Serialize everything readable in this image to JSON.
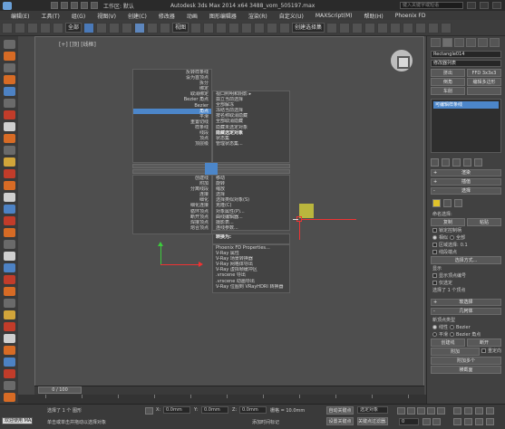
{
  "titlebar": {
    "workspace": "工作区: 默认",
    "title": "Autodesk 3ds Max  2014 x64     3488_vom_505197.max",
    "search_placeholder": "键入关键字或短语"
  },
  "menubar": [
    "编辑(E)",
    "工具(T)",
    "组(G)",
    "视图(V)",
    "创建(C)",
    "修改器",
    "动画",
    "图形编辑器",
    "渲染(R)",
    "自定义(U)",
    "MAXScript(M)",
    "帮助(H)",
    "Phoenix FD"
  ],
  "toolbar": {
    "filter": "全部",
    "ref_coord": "视图",
    "selection_set": "创建选择集"
  },
  "viewport": {
    "label": "[+] [顶] [线框]"
  },
  "quad_menu": {
    "left_top": [
      "点",
      ""
    ],
    "left_items": [
      {
        "text": "反转样条线",
        "hi": false
      },
      {
        "text": "设为首顶点",
        "hi": false
      },
      {
        "text": "拆分",
        "hi": false
      },
      {
        "text": "绑定",
        "hi": false
      },
      {
        "text": "取消绑定",
        "hi": false
      },
      {
        "text": "Bezier 角点",
        "hi": false
      },
      {
        "text": "Bezier",
        "hi": false
      },
      {
        "text": "角点",
        "hi": true
      },
      {
        "text": "平滑",
        "hi": false
      },
      {
        "text": "重置切线",
        "hi": false
      },
      {
        "text": "样条线",
        "hi": false
      },
      {
        "text": "线段",
        "hi": false
      },
      {
        "text": "顶点",
        "hi": false
      },
      {
        "text": "顶层级",
        "hi": false
      }
    ],
    "right_top_items": [
      {
        "text": "视口照明和阴影 ▸",
        "b": false
      },
      {
        "text": "孤立当前选择",
        "b": false
      },
      {
        "text": "全部解冻",
        "b": false
      },
      {
        "text": "冻结当前选择",
        "b": false
      },
      {
        "text": "按名称取消隐藏",
        "b": false
      },
      {
        "text": "全部取消隐藏",
        "b": false
      },
      {
        "text": "隐藏未选定对象",
        "b": false
      },
      {
        "text": "隐藏选定对象",
        "b": true
      },
      {
        "text": "状态集",
        "b": false
      },
      {
        "text": "管理状态集...",
        "b": false
      }
    ],
    "sec_labels": [
      "工具 1",
      "工具 2",
      "显示",
      "变换"
    ],
    "left_lower_items": [
      "创建线",
      "附加",
      "分离线段",
      "连接",
      "细化",
      "细化连接",
      "循环顶点",
      "断开顶点",
      "焊接顶点",
      "熔合顶点"
    ],
    "right_mid_items": [
      "移动",
      "旋转",
      "缩放",
      "选择",
      "选择类似对象(S)",
      "克隆(C)",
      "对象属性(P)...",
      "曲线编辑器...",
      "摄影表...",
      "连线参数..."
    ],
    "right_low_items": [
      {
        "text": "转换为:",
        "b": true
      },
      {
        "text": "Phoenix FD Properties...",
        "b": false
      },
      {
        "text": "V-Ray 属性",
        "b": false
      },
      {
        "text": "V-Ray 场景转换器",
        "b": false
      },
      {
        "text": "V-Ray 网格体导出",
        "b": false
      },
      {
        "text": "V-Ray 虚拟帧缓冲区",
        "b": false
      },
      {
        "text": ".vrscene 导出",
        "b": false
      },
      {
        "text": ".vrscene 动画导出",
        "b": false
      },
      {
        "text": "V-Ray 位图到 VRayHDRI 转换器",
        "b": false
      },
      {
        "text": "V-Ray 场景文件导出",
        "b": false
      }
    ]
  },
  "right_panel": {
    "object_name": "Rectangle014",
    "modifier_list": "修改器列表",
    "buttons_row1": [
      "挤出",
      "FFD 3x3x3"
    ],
    "buttons_row2": [
      "倒角",
      "编辑多边形"
    ],
    "buttons_row3": [
      "车削",
      ""
    ],
    "stack_item": "可编辑样条线",
    "rollouts": {
      "render": "渲染",
      "interp": "插值",
      "select": "选择",
      "soft_select": "软选择",
      "geometry": "几何体"
    },
    "named_sel": "命名选择:",
    "copy_btn": "复制",
    "paste_btn": "粘贴",
    "lock_handles": "锁定控制柄",
    "similar": "相似",
    "all": "全部",
    "area_select": "区域选择:",
    "area_val": "0.1",
    "segment_end": "线段端点",
    "select_by": "选择方式...",
    "display": "显示",
    "show_vnum": "显示顶点编号",
    "only_selected": "仅选定",
    "selected_count": "选择了 1 个顶点",
    "new_vert_type": "新顶点类型",
    "linear": "线性",
    "bezier": "Bezier",
    "smooth": "平滑",
    "bezier_corner": "Bezier 角点",
    "create_line": "创建线",
    "break_btn": "断开",
    "attach": "附加",
    "reorient": "重定向",
    "attach_multi": "附加多个",
    "cross_section": "横截面"
  },
  "timeline": {
    "slider": "0 / 100"
  },
  "status": {
    "selected": "选择了 1 个 图形",
    "prompt": "单击或单击并拖动以选择对象",
    "welcome": "欢迎使用 MAXScript。",
    "x_val": "0.0mm",
    "y_val": "0.0mm",
    "z_val": "0.0mm",
    "grid": "栅格 = 10.0mm",
    "autokey": "自动关键点",
    "selected_obj": "选定对象",
    "set_key": "设置关键点",
    "key_filter": "关键点过滤器...",
    "add_time_tag": "添加时间标记",
    "frame": "0"
  }
}
